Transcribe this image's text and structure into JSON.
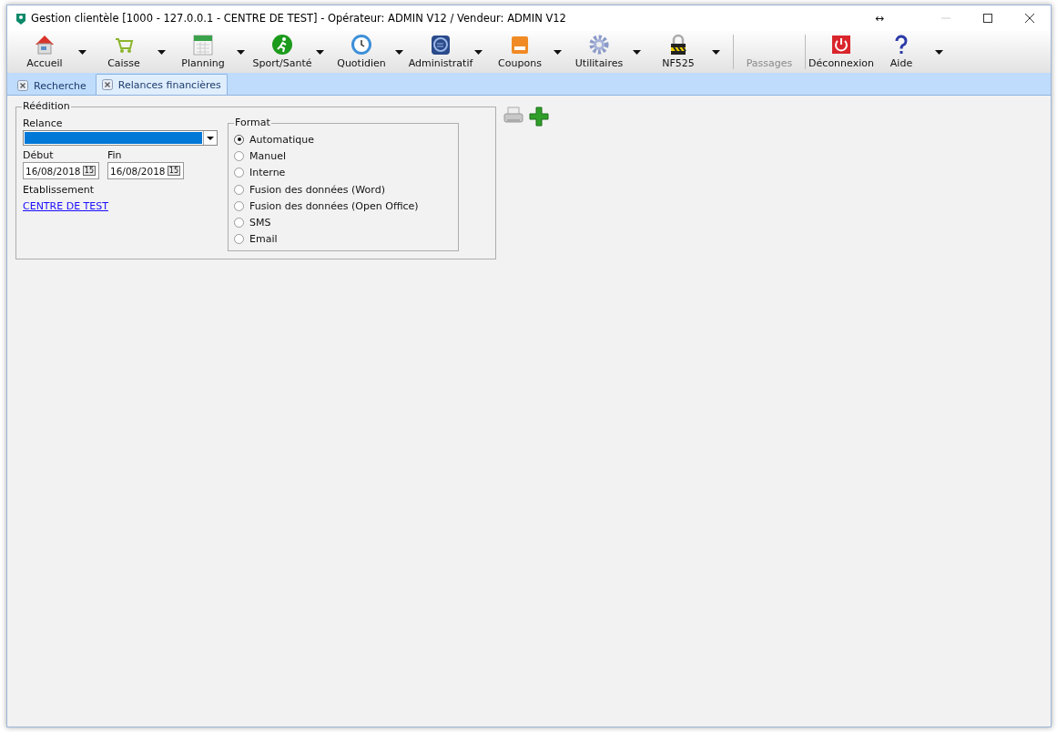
{
  "window": {
    "title": "Gestion clientèle [1000 - 127.0.0.1 - CENTRE DE TEST] - Opérateur: ADMIN V12 / Vendeur: ADMIN V12",
    "resize_glyph": "↔"
  },
  "toolbar": [
    {
      "label": "Accueil",
      "menu": true,
      "disabled": false,
      "separator_before": false
    },
    {
      "label": "Caisse",
      "menu": true,
      "disabled": false,
      "separator_before": false
    },
    {
      "label": "Planning",
      "menu": true,
      "disabled": false,
      "separator_before": false
    },
    {
      "label": "Sport/Santé",
      "menu": true,
      "disabled": false,
      "separator_before": false
    },
    {
      "label": "Quotidien",
      "menu": true,
      "disabled": false,
      "separator_before": false
    },
    {
      "label": "Administratif",
      "menu": true,
      "disabled": false,
      "separator_before": false
    },
    {
      "label": "Coupons",
      "menu": true,
      "disabled": false,
      "separator_before": false
    },
    {
      "label": "Utilitaires",
      "menu": true,
      "disabled": false,
      "separator_before": false
    },
    {
      "label": "NF525",
      "menu": true,
      "disabled": false,
      "separator_before": false
    },
    {
      "label": "Passages",
      "menu": false,
      "disabled": true,
      "separator_before": true
    },
    {
      "label": "Déconnexion",
      "menu": false,
      "disabled": false,
      "separator_before": true
    },
    {
      "label": "Aide",
      "menu": true,
      "disabled": false,
      "separator_before": false
    }
  ],
  "tabs": [
    {
      "label": "Recherche",
      "selected": false
    },
    {
      "label": "Relances financières",
      "selected": true
    }
  ],
  "reedition": {
    "title": "Réédition",
    "relance": {
      "label": "Relance"
    },
    "debut": {
      "label": "Début",
      "value": "16/08/2018",
      "picker": "15"
    },
    "fin": {
      "label": "Fin",
      "value": "16/08/2018",
      "picker": "15"
    },
    "etablissement": {
      "label": "Etablissement",
      "link": "CENTRE DE TEST"
    },
    "format": {
      "title": "Format",
      "options": [
        {
          "label": "Automatique",
          "selected": true
        },
        {
          "label": "Manuel",
          "selected": false
        },
        {
          "label": "Interne",
          "selected": false
        },
        {
          "label": "Fusion des données (Word)",
          "selected": false
        },
        {
          "label": "Fusion des données (Open Office)",
          "selected": false
        },
        {
          "label": "SMS",
          "selected": false
        },
        {
          "label": "Email",
          "selected": false
        }
      ]
    }
  }
}
